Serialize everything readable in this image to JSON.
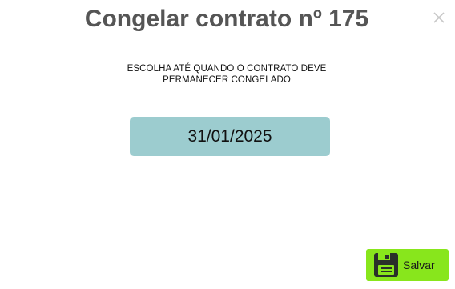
{
  "dialog": {
    "title": "Congelar contrato nº 175",
    "close_icon": "close-icon",
    "instruction": {
      "line1": "ESCOLHA ATÉ QUANDO O CONTRATO DEVE",
      "line2": "PERMANECER CONGELADO"
    },
    "date_field": {
      "value": "31/01/2025",
      "background": "#9ccccf"
    },
    "save_button": {
      "label": "Salvar",
      "icon": "floppy-disk-icon",
      "background": "#88e61c"
    }
  }
}
